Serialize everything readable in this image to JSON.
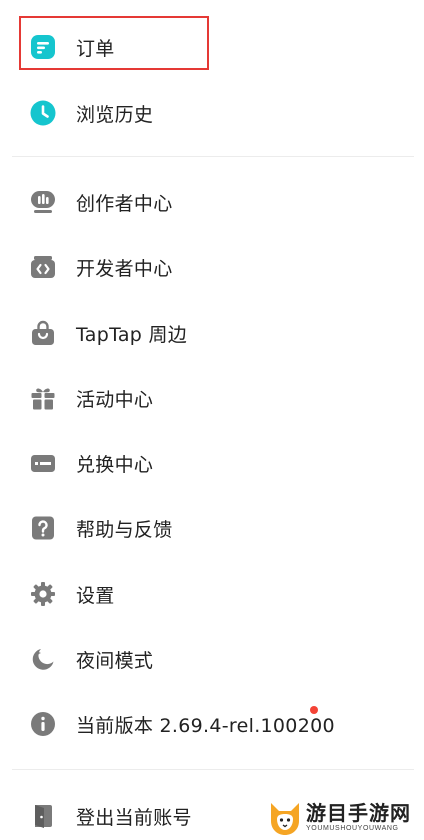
{
  "menu": {
    "group1": [
      {
        "label": "订单",
        "icon": "order-icon"
      },
      {
        "label": "浏览历史",
        "icon": "clock-icon"
      }
    ],
    "group2": [
      {
        "label": "创作者中心",
        "icon": "creator-icon"
      },
      {
        "label": "开发者中心",
        "icon": "code-icon"
      },
      {
        "label": "TapTap 周边",
        "icon": "shopping-bag-icon"
      },
      {
        "label": "活动中心",
        "icon": "gift-icon"
      },
      {
        "label": "兑换中心",
        "icon": "redeem-card-icon"
      },
      {
        "label": "帮助与反馈",
        "icon": "help-icon"
      },
      {
        "label": "设置",
        "icon": "gear-icon"
      },
      {
        "label": "夜间模式",
        "icon": "moon-icon"
      },
      {
        "label": "当前版本 2.69.4-rel.100200",
        "icon": "info-icon"
      }
    ],
    "group3": [
      {
        "label": "登出当前账号",
        "icon": "logout-icon"
      }
    ]
  },
  "colors": {
    "accent": "#15c5ce",
    "icon_gray": "#7a7a7a",
    "highlight": "#e53935",
    "badge": "#f44336"
  },
  "watermark": {
    "title": "游目手游网",
    "subtitle": "YOUMUSHOUYOUWANG"
  }
}
